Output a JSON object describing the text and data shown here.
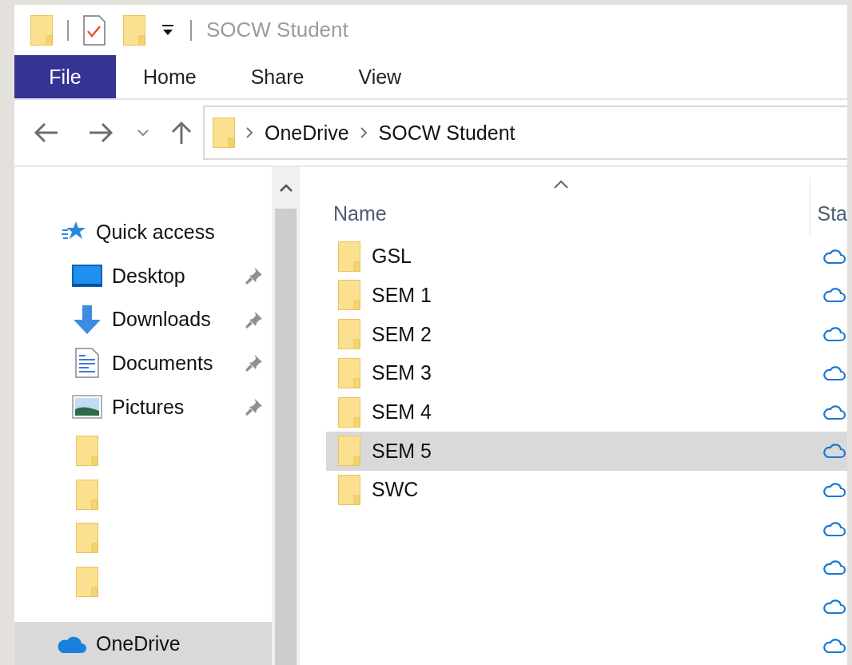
{
  "window": {
    "title": "SOCW Student"
  },
  "ribbon_tabs": [
    {
      "label": "File",
      "kind": "file",
      "selected": false
    },
    {
      "label": "Home",
      "kind": "tab",
      "selected": false
    },
    {
      "label": "Share",
      "kind": "tab",
      "selected": false
    },
    {
      "label": "View",
      "kind": "tab",
      "selected": false
    }
  ],
  "address_bar": {
    "crumbs": [
      "OneDrive",
      "SOCW Student"
    ]
  },
  "sidebar": {
    "items": [
      {
        "label": "Quick access",
        "kind": "quick-access",
        "pinned": false,
        "selected": false
      },
      {
        "label": "Desktop",
        "kind": "desktop",
        "pinned": true,
        "selected": false
      },
      {
        "label": "Downloads",
        "kind": "downloads",
        "pinned": true,
        "selected": false
      },
      {
        "label": "Documents",
        "kind": "documents",
        "pinned": true,
        "selected": false
      },
      {
        "label": "Pictures",
        "kind": "pictures",
        "pinned": true,
        "selected": false
      },
      {
        "kind": "folder",
        "pinned": false,
        "selected": false
      },
      {
        "kind": "folder",
        "pinned": false,
        "selected": false
      },
      {
        "kind": "folder",
        "pinned": false,
        "selected": false
      },
      {
        "kind": "folder",
        "pinned": false,
        "selected": false
      },
      {
        "label": "OneDrive",
        "kind": "onedrive",
        "pinned": false,
        "selected": true
      }
    ]
  },
  "columns": [
    {
      "label": "Name",
      "sorted": true
    },
    {
      "label": "Sta"
    }
  ],
  "rows": [
    {
      "name": "GSL",
      "selected": false
    },
    {
      "name": "SEM 1",
      "selected": false
    },
    {
      "name": "SEM 2",
      "selected": false
    },
    {
      "name": "SEM 3",
      "selected": false
    },
    {
      "name": "SEM 4",
      "selected": false
    },
    {
      "name": "SEM 5",
      "selected": true
    },
    {
      "name": "SWC",
      "selected": false
    },
    {
      "selected": false
    },
    {
      "selected": false
    },
    {
      "selected": false
    },
    {
      "selected": false
    }
  ]
}
